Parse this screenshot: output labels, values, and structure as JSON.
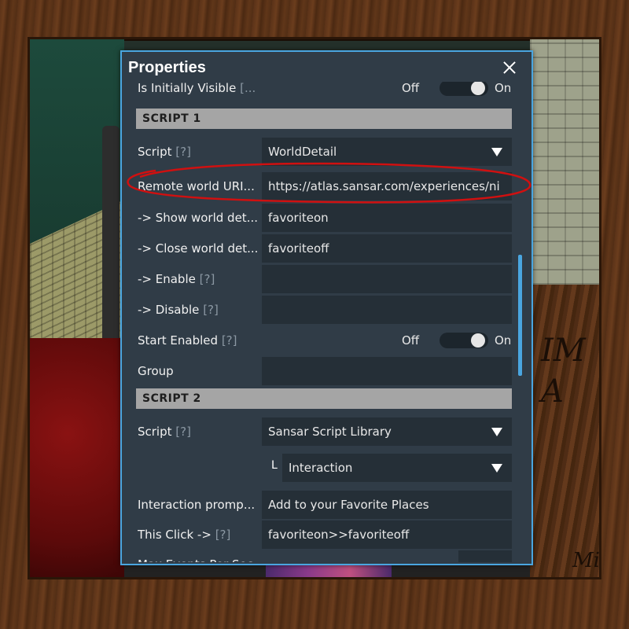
{
  "panel": {
    "title": "Properties"
  },
  "rows": {
    "initially_visible": {
      "label": "Is Initially Visible",
      "help": "[...",
      "off": "Off",
      "on": "On"
    },
    "script1_header": "SCRIPT 1",
    "script1": {
      "label": "Script",
      "help": "[?]",
      "value": "WorldDetail"
    },
    "remote_uri": {
      "label": "Remote world  URI...",
      "value": "https://atlas.sansar.com/experiences/ni"
    },
    "show_world": {
      "label": "-> Show world det...",
      "value": "favoriteon"
    },
    "close_world": {
      "label": "-> Close world det...",
      "value": "favoriteoff"
    },
    "enable": {
      "label": "-> Enable",
      "help": "[?]",
      "value": ""
    },
    "disable": {
      "label": "-> Disable",
      "help": "[?]",
      "value": ""
    },
    "start_enabled": {
      "label": "Start  Enabled",
      "help": "[?]",
      "off": "Off",
      "on": "On"
    },
    "group": {
      "label": "Group",
      "value": ""
    },
    "script2_header": "SCRIPT 2",
    "script2": {
      "label": "Script",
      "help": "[?]",
      "value": "Sansar Script Library"
    },
    "interaction_sub": {
      "marker": "L",
      "value": "Interaction"
    },
    "interaction_prompt": {
      "label": "Interaction promp...",
      "value": "Add to your Favorite Places"
    },
    "this_click": {
      "label": "This  Click ->",
      "help": "[?]",
      "value": "favoriteon>>favoriteoff"
    },
    "max_events": {
      "label": "Max Events Per Sec..."
    }
  },
  "background": {
    "plaque_text": "IM\nA",
    "plaque_text2": "Mix"
  },
  "colors": {
    "panel_bg": "#303c47",
    "panel_border": "#4aa6e0",
    "field_bg": "#252f37",
    "section_bg": "#a5a5a5",
    "annotation": "#d01010"
  }
}
